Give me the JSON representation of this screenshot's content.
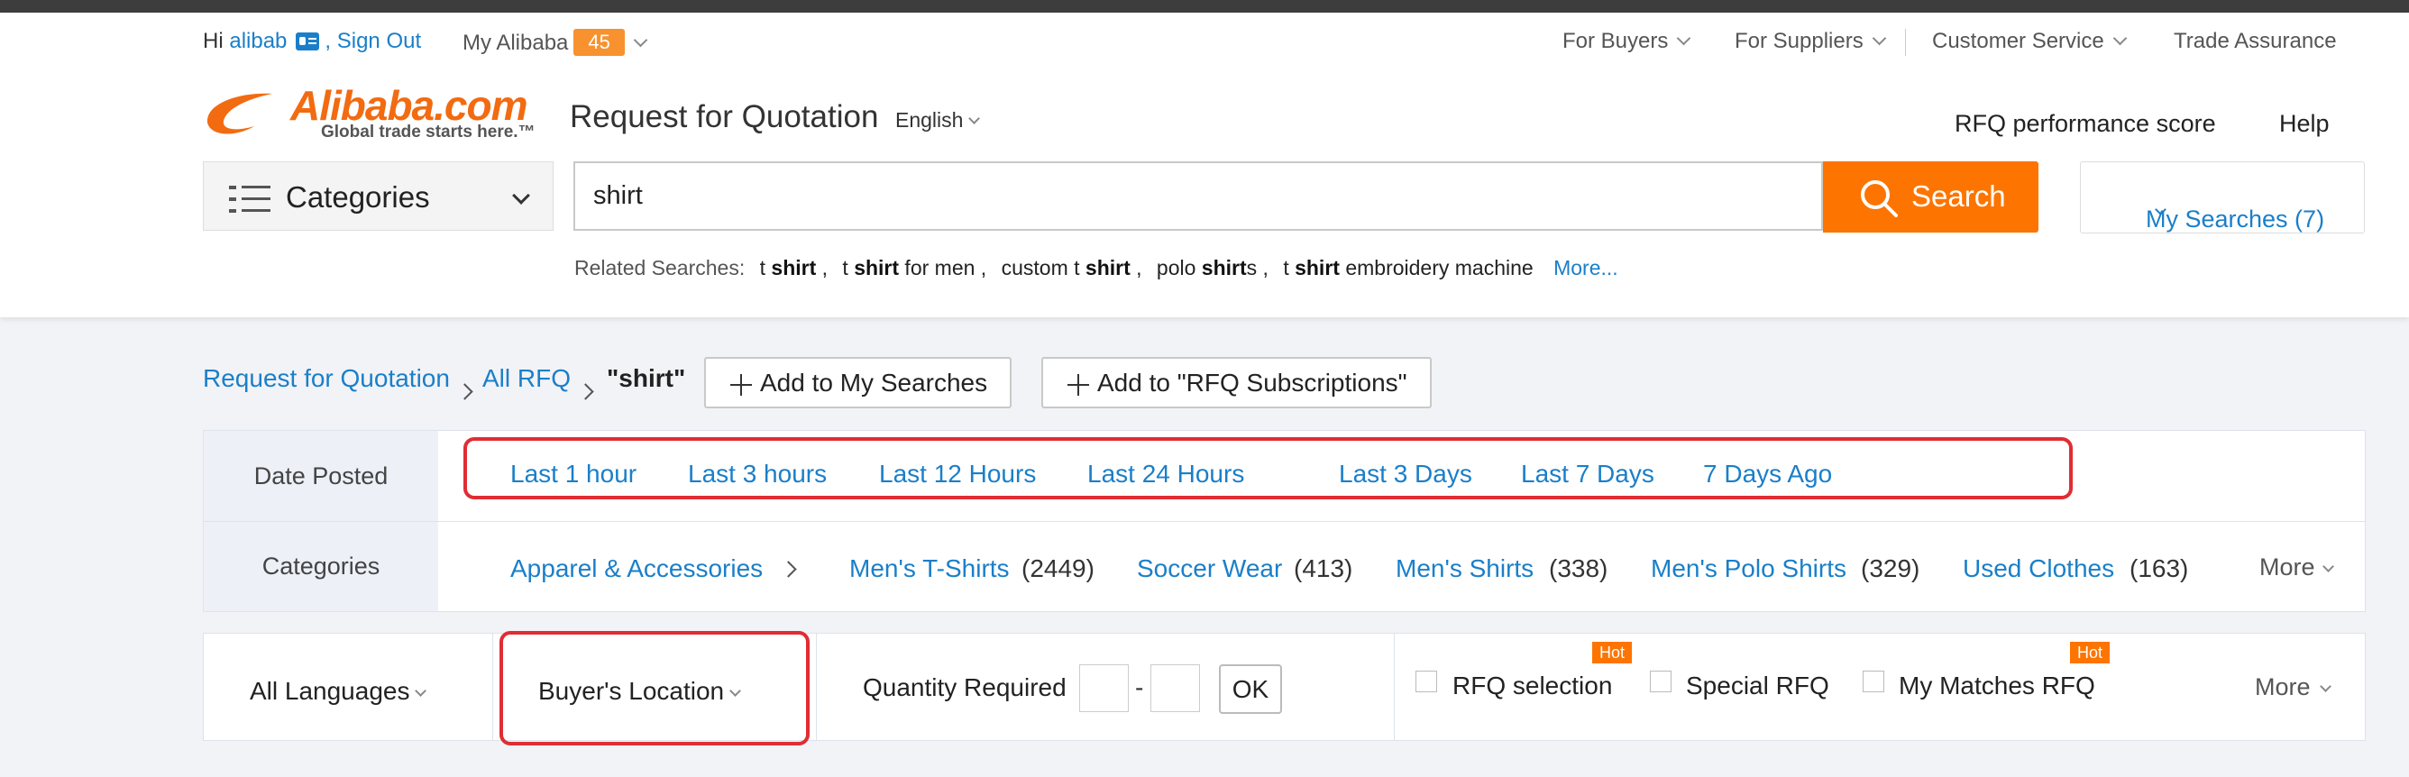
{
  "topbar": {
    "greeting": "Hi",
    "username": "alibab",
    "sign_out": ", Sign Out",
    "my_alibaba": "My Alibaba",
    "badge_count": "45",
    "nav": [
      "For Buyers",
      "For Suppliers",
      "Customer Service",
      "Trade Assurance"
    ]
  },
  "logo": {
    "wordmark": "Alibaba.com",
    "tagline": "Global trade starts here.™"
  },
  "header": {
    "title": "Request for Quotation",
    "language": "English",
    "performance": "RFQ performance score",
    "help": "Help"
  },
  "search": {
    "categories_label": "Categories",
    "query": "shirt",
    "button": "Search",
    "my_searches": "My Searches (7)"
  },
  "related": {
    "label": "Related Searches:",
    "items": [
      {
        "pre": "t ",
        "bold": "shirt",
        "post": " ,"
      },
      {
        "pre": "t ",
        "bold": "shirt",
        "post": " for men ,"
      },
      {
        "pre": "custom t ",
        "bold": "shirt",
        "post": " ,"
      },
      {
        "pre": "polo ",
        "bold": "shirt",
        "post": "s ,"
      },
      {
        "pre": "t ",
        "bold": "shirt",
        "post": " embroidery machine"
      }
    ],
    "more": "More..."
  },
  "breadcrumb": {
    "root": "Request for Quotation",
    "all": "All RFQ",
    "current": "\"shirt\"",
    "add_searches": "Add to My Searches",
    "add_subs": "Add to \"RFQ Subscriptions\""
  },
  "filters": {
    "date_label": "Date Posted",
    "dates": [
      "Last 1 hour",
      "Last 3 hours",
      "Last 12 Hours",
      "Last 24 Hours",
      "Last 3 Days",
      "Last 7 Days",
      "7 Days Ago"
    ],
    "categories_label": "Categories",
    "parent_category": "Apparel & Accessories",
    "categories": [
      {
        "name": "Men's T-Shirts",
        "count": "(2449)"
      },
      {
        "name": "Soccer Wear",
        "count": "(413)"
      },
      {
        "name": "Men's Shirts",
        "count": "(338)"
      },
      {
        "name": "Men's Polo Shirts",
        "count": "(329)"
      },
      {
        "name": "Used Clothes",
        "count": "(163)"
      }
    ],
    "more": "More"
  },
  "filters2": {
    "languages": "All Languages",
    "location": "Buyer's Location",
    "quantity_label": "Quantity Required",
    "dash": "-",
    "ok": "OK",
    "checks": [
      {
        "label": "RFQ selection",
        "hot": "Hot"
      },
      {
        "label": "Special RFQ",
        "hot": ""
      },
      {
        "label": "My Matches RFQ",
        "hot": "Hot"
      }
    ],
    "more": "More"
  },
  "colors": {
    "accent": "#fe7400",
    "link": "#1a7fc9",
    "highlight": "#e02d33"
  }
}
